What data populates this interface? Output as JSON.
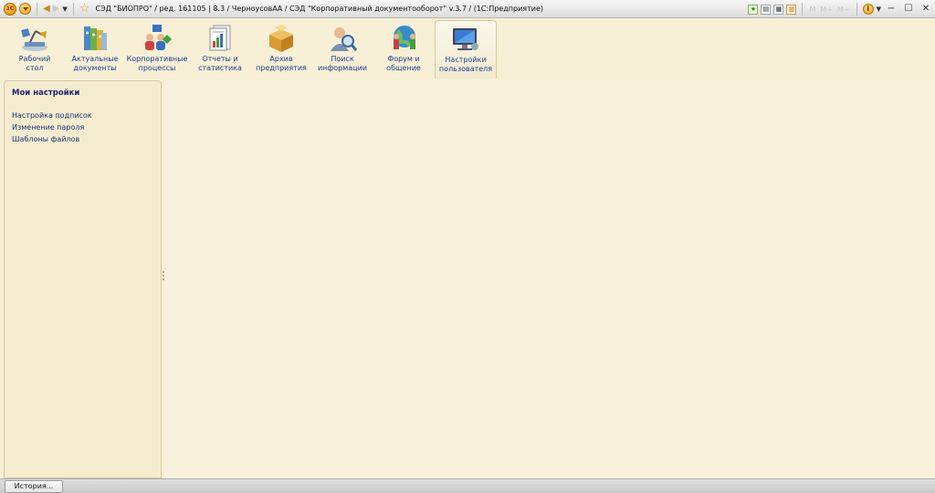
{
  "window": {
    "title": "СЭД \"БИОПРО\" / ред. 161105 | 8.3 /  ЧерноусовАА / СЭД \"Корпоративный документооборот\" v.3.7 /  (1С:Предприятие)",
    "toolbar_right": {
      "mem_buttons": [
        "M",
        "M+",
        "M−"
      ]
    }
  },
  "sections": [
    {
      "label": "Рабочий\nстол",
      "icon": "desktop-lamp-icon"
    },
    {
      "label": "Актуальные\nдокументы",
      "icon": "binders-icon"
    },
    {
      "label": "Корпоративные\nпроцессы",
      "icon": "people-process-icon"
    },
    {
      "label": "Отчеты и\nстатистика",
      "icon": "reports-icon"
    },
    {
      "label": "Архив\nпредприятия",
      "icon": "archive-box-icon"
    },
    {
      "label": "Поиск\nинформации",
      "icon": "search-person-icon"
    },
    {
      "label": "Форум и\nобщение",
      "icon": "forum-globe-icon"
    },
    {
      "label": "Настройки\nпользователя",
      "icon": "user-settings-monitor-icon",
      "active": true
    }
  ],
  "left_pane": {
    "title": "Мои настройки",
    "links": [
      "Настройка подписок",
      "Изменение пароля",
      "Шаблоны файлов"
    ]
  },
  "bottom": {
    "history_label": "История..."
  }
}
